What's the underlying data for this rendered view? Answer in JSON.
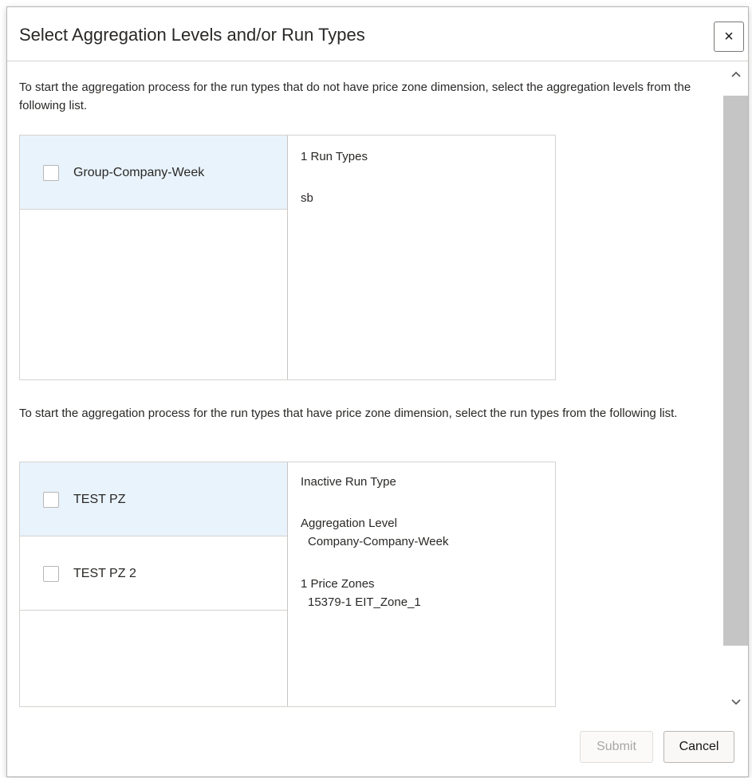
{
  "dialog": {
    "title": "Select Aggregation Levels and/or Run Types",
    "close_label": "×"
  },
  "section1": {
    "instruction": "To start the aggregation process for the run types that do not have price zone dimension, select the aggregation levels from the following list.",
    "items": [
      {
        "label": "Group-Company-Week",
        "selected": true,
        "checked": false
      }
    ],
    "detail": {
      "run_types_count": "1 Run Types",
      "run_type_name": "sb"
    }
  },
  "section2": {
    "instruction": "To start the aggregation process for the run types that have price zone dimension, select the run types from the following list.",
    "items": [
      {
        "label": "TEST PZ",
        "selected": true,
        "checked": false
      },
      {
        "label": "TEST PZ 2",
        "selected": false,
        "checked": false
      }
    ],
    "detail": {
      "status": "Inactive Run Type",
      "aggregation_level_label": "Aggregation Level",
      "aggregation_level_value": "Company-Company-Week",
      "price_zones_label": "1 Price Zones",
      "price_zone_value": "15379-1 EIT_Zone_1"
    }
  },
  "footer": {
    "submit_label": "Submit",
    "cancel_label": "Cancel",
    "submit_disabled": true
  },
  "icons": {
    "close": "close-icon",
    "scroll_up": "chevron-up-icon",
    "scroll_down": "chevron-down-icon"
  }
}
